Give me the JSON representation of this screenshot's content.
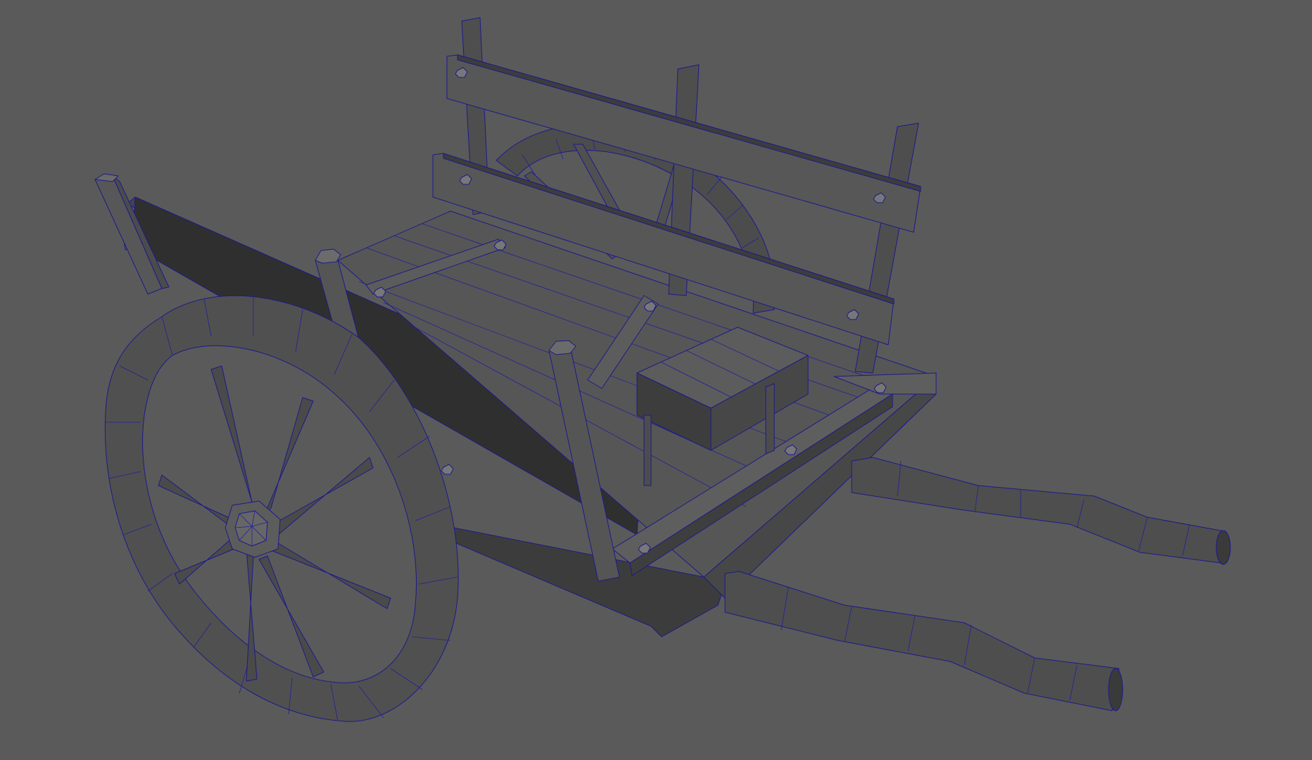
{
  "viewport": {
    "background": "#5a5a5a",
    "shading": "smooth-shade-with-wireframe",
    "wireframe_color": "#1c1a8c",
    "model_color": "#555555"
  },
  "scene": {
    "object": "wooden-cart-model",
    "parts": [
      "wheel",
      "wheel",
      "bed",
      "back-rail",
      "side-rail",
      "stakes",
      "handles",
      "bolts"
    ]
  }
}
